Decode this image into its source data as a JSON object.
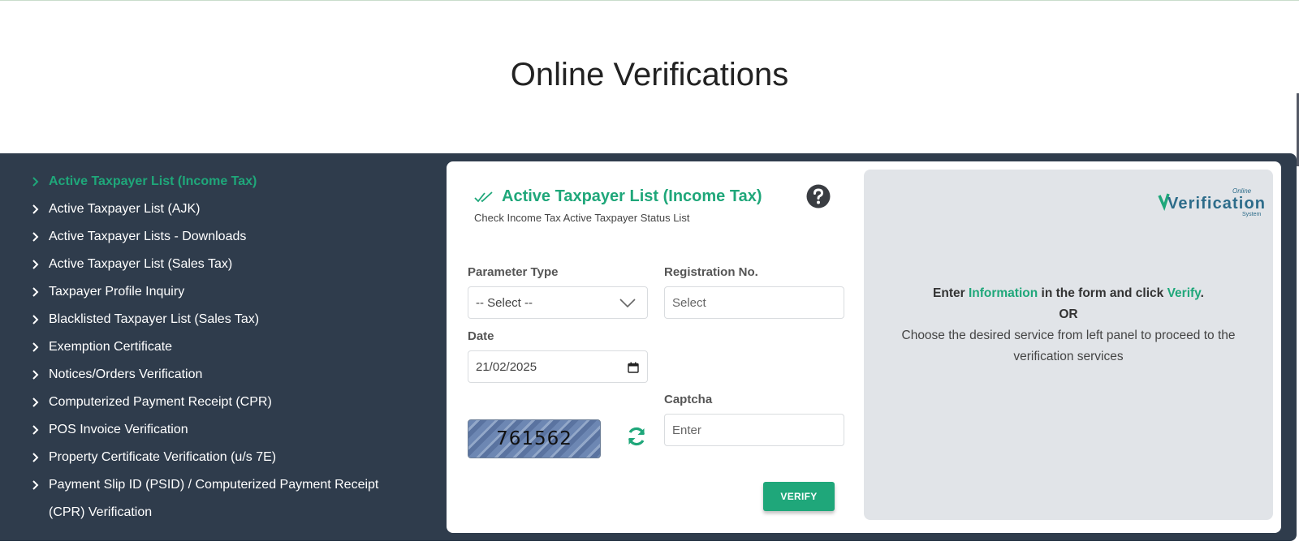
{
  "page": {
    "title": "Online Verifications"
  },
  "colors": {
    "accent": "#1fa77a",
    "panel_bg": "#2f3c4c",
    "info_bg": "#e1e4e8"
  },
  "sidebar": {
    "items": [
      {
        "label": "Active Taxpayer List (Income Tax)",
        "active": true
      },
      {
        "label": "Active Taxpayer List (AJK)"
      },
      {
        "label": "Active Taxpayer Lists - Downloads"
      },
      {
        "label": "Active Taxpayer List (Sales Tax)"
      },
      {
        "label": "Taxpayer Profile Inquiry"
      },
      {
        "label": "Blacklisted Taxpayer List (Sales Tax)"
      },
      {
        "label": "Exemption Certificate"
      },
      {
        "label": "Notices/Orders Verification"
      },
      {
        "label": "Computerized Payment Receipt (CPR)"
      },
      {
        "label": "POS Invoice Verification"
      },
      {
        "label": "Property Certificate Verification (u/s 7E)"
      },
      {
        "label": "Payment Slip ID (PSID) / Computerized Payment Receipt (CPR) Verification"
      }
    ]
  },
  "form": {
    "title": "Active Taxpayer List (Income Tax)",
    "subtitle": "Check Income Tax Active Taxpayer Status List",
    "help_icon": "question-circle-icon",
    "parameter_type": {
      "label": "Parameter Type",
      "value": "-- Select --"
    },
    "registration_no": {
      "label": "Registration No.",
      "placeholder": "Select"
    },
    "date": {
      "label": "Date",
      "value": "21/02/2025"
    },
    "captcha": {
      "label": "Captcha",
      "code": "761562",
      "placeholder": "Enter"
    },
    "verify_label": "VERIFY"
  },
  "info": {
    "logo_small": "Online",
    "logo_main": "Verification",
    "logo_sub": "System",
    "line1_a": "Enter ",
    "line1_hl1": "Information",
    "line1_b": " in the form and click ",
    "line1_hl2": "Verify",
    "line1_c": ".",
    "or": "OR",
    "line2": "Choose the desired service from left panel to proceed to the verification services"
  }
}
